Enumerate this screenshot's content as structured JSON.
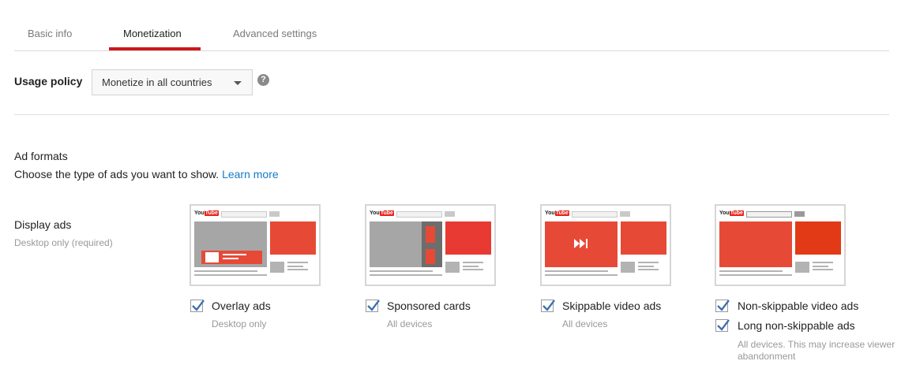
{
  "tabs": [
    {
      "label": "Basic info"
    },
    {
      "label": "Monetization"
    },
    {
      "label": "Advanced settings"
    }
  ],
  "active_tab": "Monetization",
  "usage_policy": {
    "label": "Usage policy",
    "selected": "Monetize in all countries",
    "help_icon": "?"
  },
  "ad_formats": {
    "title": "Ad formats",
    "description": "Choose the type of ads you want to show.",
    "learn_more": "Learn more",
    "display_ads": {
      "label": "Display ads",
      "sublabel": "Desktop only (required)"
    },
    "options": [
      {
        "label": "Overlay ads",
        "sub": "Desktop only",
        "checked": true,
        "icon": "overlay-ads-preview-icon"
      },
      {
        "label": "Sponsored cards",
        "sub": "All devices",
        "checked": true,
        "icon": "sponsored-cards-preview-icon"
      },
      {
        "label": "Skippable video ads",
        "sub": "All devices",
        "checked": true,
        "icon": "skippable-video-preview-icon"
      },
      {
        "label": "Non-skippable video ads",
        "checked": true,
        "icon": "non-skippable-video-preview-icon"
      },
      {
        "label": "Long non-skippable ads",
        "sub": "All devices. This may increase viewer abandonment",
        "checked": true
      }
    ],
    "thumbnail_logo": {
      "you": "You",
      "tube": "Tube"
    }
  },
  "colors": {
    "accent_red": "#cc181e",
    "ad_red": "#e64a37",
    "link_blue": "#167ac6",
    "checkmark": "#3d6fae",
    "placeholder_gray": "#a6a6a6"
  }
}
